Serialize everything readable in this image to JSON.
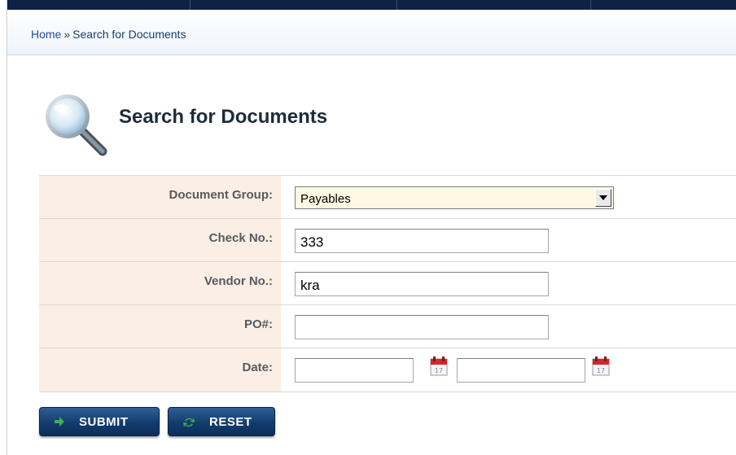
{
  "breadcrumb": {
    "home": "Home",
    "separator": "»",
    "current": "Search for Documents"
  },
  "page": {
    "title": "Search for Documents",
    "icon": "magnifier-icon"
  },
  "form": {
    "document_group": {
      "label": "Document Group:",
      "value": "Payables"
    },
    "check_no": {
      "label": "Check No.:",
      "value": "333"
    },
    "vendor_no": {
      "label": "Vendor No.:",
      "value": "kra"
    },
    "po": {
      "label": "PO#:",
      "value": ""
    },
    "date": {
      "label": "Date:",
      "from": "",
      "to": "",
      "calendar_day": "17"
    }
  },
  "buttons": {
    "submit": "SUBMIT",
    "reset": "RESET"
  },
  "colors": {
    "header_bar": "#0d2346",
    "label_bg": "#fbeee4",
    "select_bg": "#fff9e3",
    "button": "#123c6e",
    "submit_icon": "#39b54a",
    "reset_icon": "#39b54a",
    "calendar_red": "#d9232d"
  }
}
